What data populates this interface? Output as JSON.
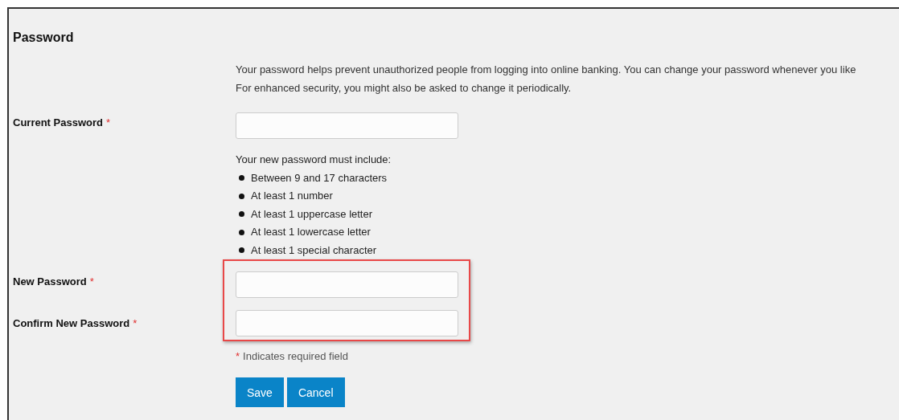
{
  "title": "Password",
  "intro": [
    "Your password helps prevent unauthorized people from logging into online banking. You can change your password whenever you like",
    "For enhanced security, you might also be asked to change it periodically."
  ],
  "current": {
    "label": "Current Password",
    "required_mark": "*"
  },
  "rules": {
    "heading": "Your new password must include:",
    "items": [
      "Between 9 and 17 characters",
      "At least 1 number",
      "At least 1 uppercase letter",
      "At least 1 lowercase letter",
      "At least 1 special character"
    ]
  },
  "new_fields": [
    {
      "label": "New Password",
      "required_mark": "*"
    },
    {
      "label": "Confirm New Password",
      "required_mark": "*"
    }
  ],
  "note": {
    "mark": "*",
    "text": "Indicates required field"
  },
  "buttons": [
    "Save",
    "Cancel"
  ]
}
